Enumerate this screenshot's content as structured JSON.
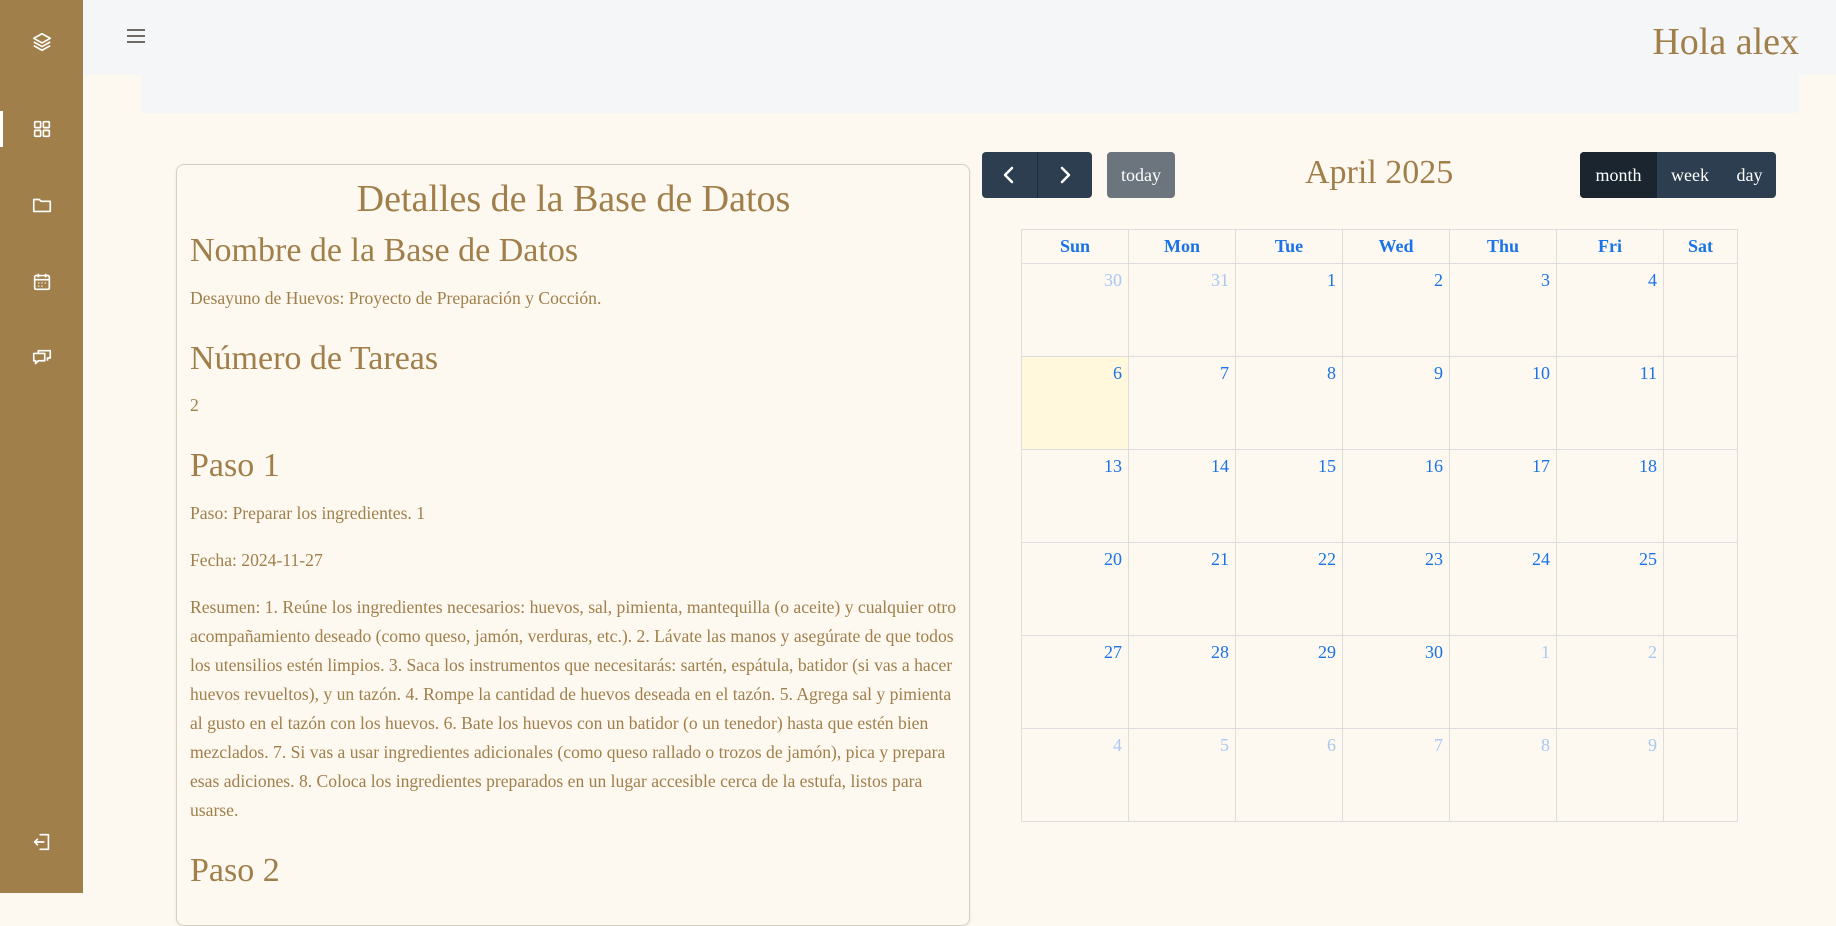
{
  "header": {
    "greeting": "Hola alex"
  },
  "sidebar": {
    "icons": [
      "layers-icon",
      "dashboard-icon",
      "folder-icon",
      "calendar-icon",
      "chat-icon",
      "logout-icon"
    ]
  },
  "details": {
    "title": "Detalles de la Base de Datos",
    "db_name_heading": "Nombre de la Base de Datos",
    "db_name": "Desayuno de Huevos: Proyecto de Preparación y Cocción.",
    "task_count_heading": "Número de Tareas",
    "task_count": "2",
    "step1_heading": "Paso 1",
    "step1_step": "Paso: Preparar los ingredientes. 1",
    "step1_date": "Fecha: 2024-11-27",
    "step1_summary": "Resumen: 1. Reúne los ingredientes necesarios: huevos, sal, pimienta, mantequilla (o aceite) y cualquier otro acompañamiento deseado (como queso, jamón, verduras, etc.). 2. Lávate las manos y asegúrate de que todos los utensilios estén limpios. 3. Saca los instrumentos que necesitarás: sartén, espátula, batidor (si vas a hacer huevos revueltos), y un tazón. 4. Rompe la cantidad de huevos deseada en el tazón. 5. Agrega sal y pimienta al gusto en el tazón con los huevos. 6. Bate los huevos con un batidor (o un tenedor) hasta que estén bien mezclados. 7. Si vas a usar ingredientes adicionales (como queso rallado o trozos de jamón), pica y prepara esas adiciones. 8. Coloca los ingredientes preparados en un lugar accesible cerca de la estufa, listos para usarse.",
    "step2_heading": "Paso 2"
  },
  "calendar": {
    "title": "April 2025",
    "today_label": "today",
    "views": [
      "month",
      "week",
      "day"
    ],
    "active_view": "month",
    "weekdays": [
      "Sun",
      "Mon",
      "Tue",
      "Wed",
      "Thu",
      "Fri",
      "Sat"
    ],
    "weeks": [
      [
        {
          "d": "30",
          "o": true
        },
        {
          "d": "31",
          "o": true
        },
        {
          "d": "1"
        },
        {
          "d": "2"
        },
        {
          "d": "3"
        },
        {
          "d": "4"
        },
        {
          "d": ""
        }
      ],
      [
        {
          "d": "6",
          "t": true
        },
        {
          "d": "7"
        },
        {
          "d": "8"
        },
        {
          "d": "9"
        },
        {
          "d": "10"
        },
        {
          "d": "11"
        },
        {
          "d": ""
        }
      ],
      [
        {
          "d": "13"
        },
        {
          "d": "14"
        },
        {
          "d": "15"
        },
        {
          "d": "16"
        },
        {
          "d": "17"
        },
        {
          "d": "18"
        },
        {
          "d": ""
        }
      ],
      [
        {
          "d": "20"
        },
        {
          "d": "21"
        },
        {
          "d": "22"
        },
        {
          "d": "23"
        },
        {
          "d": "24"
        },
        {
          "d": "25"
        },
        {
          "d": ""
        }
      ],
      [
        {
          "d": "27"
        },
        {
          "d": "28"
        },
        {
          "d": "29"
        },
        {
          "d": "30"
        },
        {
          "d": "1",
          "o": true
        },
        {
          "d": "2",
          "o": true
        },
        {
          "d": ""
        }
      ],
      [
        {
          "d": "4",
          "o": true
        },
        {
          "d": "5",
          "o": true
        },
        {
          "d": "6",
          "o": true
        },
        {
          "d": "7",
          "o": true
        },
        {
          "d": "8",
          "o": true
        },
        {
          "d": "9",
          "o": true
        },
        {
          "d": ""
        }
      ]
    ]
  }
}
